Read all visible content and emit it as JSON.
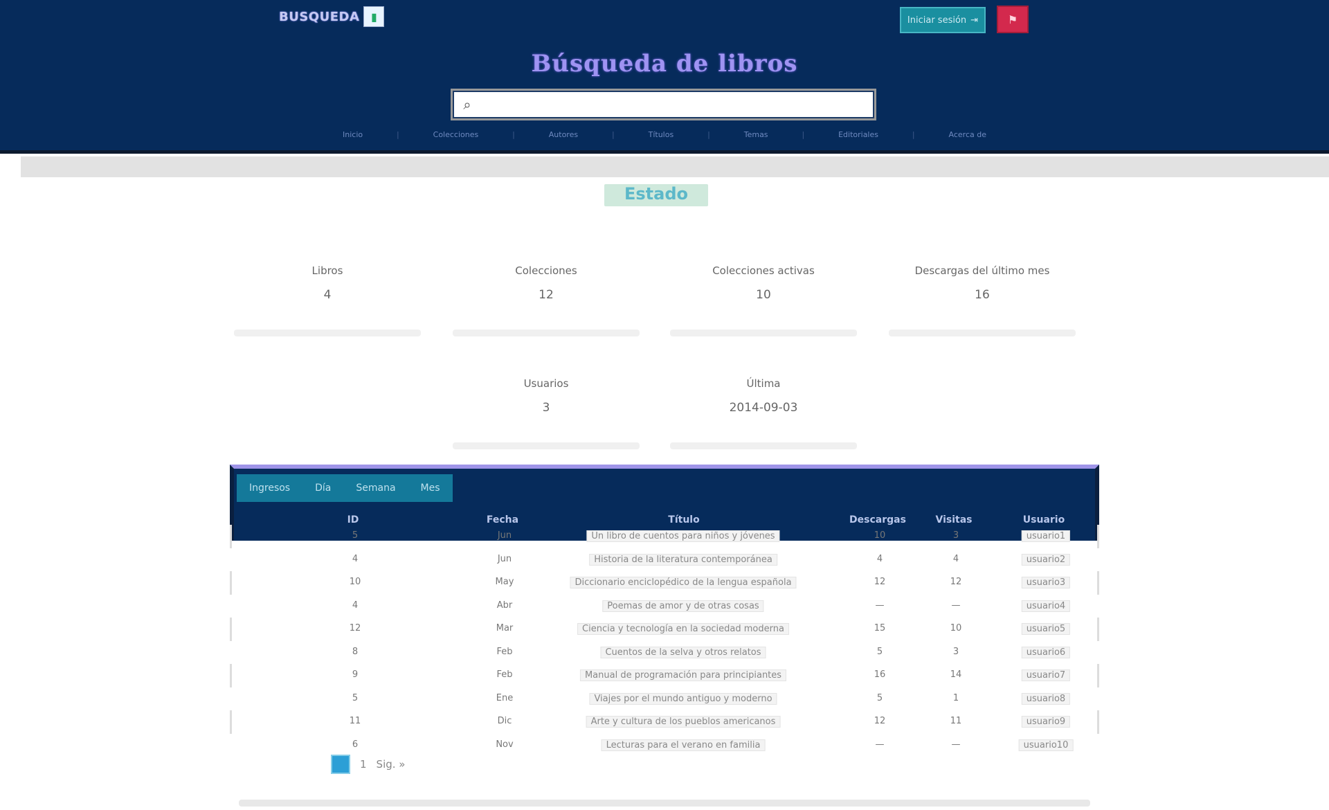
{
  "header": {
    "logo_text": "BUSQUEDA",
    "logo_icon": "book-icon",
    "login_label": "Iniciar sesión",
    "flag_icon": "flag-icon",
    "site_title": "Búsqueda de libros",
    "search": {
      "value": "",
      "placeholder": ""
    },
    "nav_links": [
      "Inicio",
      "Colecciones",
      "Autores",
      "Títulos",
      "Temas",
      "Editoriales",
      "Acerca de"
    ]
  },
  "status": {
    "title": "Estado"
  },
  "stats": [
    {
      "label": "Libros",
      "value": "4"
    },
    {
      "label": "Colecciones",
      "value": "12"
    },
    {
      "label": "Colecciones activas",
      "value": "10"
    },
    {
      "label": "Descargas del último mes",
      "value": "16"
    },
    {
      "label": "Usuarios",
      "value": "3"
    },
    {
      "label": "Última",
      "value": "2014-09-03"
    }
  ],
  "table": {
    "tabs": [
      "Ingresos",
      "Día",
      "Semana",
      "Mes"
    ],
    "columns": [
      "ID",
      "Fecha",
      "Título",
      "Descargas",
      "Visitas",
      "Usuario"
    ],
    "rows": [
      {
        "id": "5",
        "date": "Jun",
        "title": "Un libro de cuentos para niños y jóvenes",
        "downloads": "10",
        "visits": "3",
        "user": "usuario1"
      },
      {
        "id": "4",
        "date": "Jun",
        "title": "Historia de la literatura contemporánea",
        "downloads": "4",
        "visits": "4",
        "user": "usuario2"
      },
      {
        "id": "10",
        "date": "May",
        "title": "Diccionario enciclopédico de la lengua española",
        "downloads": "12",
        "visits": "12",
        "user": "usuario3"
      },
      {
        "id": "4",
        "date": "Abr",
        "title": "Poemas de amor y de otras cosas",
        "downloads": "—",
        "visits": "—",
        "user": "usuario4"
      },
      {
        "id": "12",
        "date": "Mar",
        "title": "Ciencia y tecnología en la sociedad moderna",
        "downloads": "15",
        "visits": "10",
        "user": "usuario5"
      },
      {
        "id": "8",
        "date": "Feb",
        "title": "Cuentos de la selva y otros relatos",
        "downloads": "5",
        "visits": "3",
        "user": "usuario6"
      },
      {
        "id": "9",
        "date": "Feb",
        "title": "Manual de programación para principiantes",
        "downloads": "16",
        "visits": "14",
        "user": "usuario7"
      },
      {
        "id": "5",
        "date": "Ene",
        "title": "Viajes por el mundo antiguo y moderno",
        "downloads": "5",
        "visits": "1",
        "user": "usuario8"
      },
      {
        "id": "11",
        "date": "Dic",
        "title": "Arte y cultura de los pueblos americanos",
        "downloads": "12",
        "visits": "11",
        "user": "usuario9"
      },
      {
        "id": "6",
        "date": "Nov",
        "title": "Lecturas para el verano en familia",
        "downloads": "—",
        "visits": "—",
        "user": "usuario10"
      }
    ]
  },
  "pagination": {
    "current": "1",
    "next": "Sig. »"
  },
  "colors": {
    "header_bg": "#062b5b",
    "accent": "#9f94e8",
    "teal": "#14799a",
    "status": "#5cb8c9"
  }
}
